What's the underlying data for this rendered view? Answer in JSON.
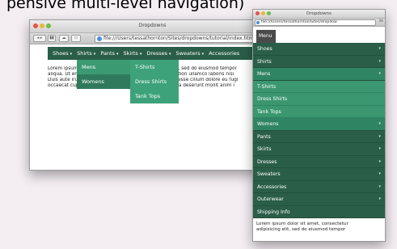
{
  "headline": "pensive multi-level navigation)",
  "desktop": {
    "title": "Dropdowns",
    "url": "file:///Users/tessathornton/Sites/dropdowns/tutorial/index.html",
    "nav": [
      "Shoes",
      "Shirts",
      "Pants",
      "Skirts",
      "Dresses",
      "Sweaters",
      "Accessories"
    ],
    "caret": "▾",
    "dropdown1": [
      "Mens",
      "Womens"
    ],
    "dropdown2": [
      "T-Shirts",
      "Dress Shirts",
      "Tank Tops"
    ],
    "paragraph": [
      "Lorem ipsum dolor sit amet, consectetur adipisicing elit, sed do eiusmod tempor",
      "aliqua. Ut enim ad minim veniam, quis nostrud exercitation ullamco laboris nisi",
      "Duis aute irure dolor in reprehenderit in voluptate velit esse cillum dolore eu fugi",
      "occaecat cupidatat non proident, sunt in culpa qui officia deserunt mollit anim i"
    ]
  },
  "mobile": {
    "title": "Dropdowns",
    "url": "file:///Users/tessathornton/Sites/dropdow",
    "zoom": "36",
    "menu_label": "Menu",
    "items": [
      {
        "label": "Shoes",
        "level": 1,
        "caret": true
      },
      {
        "label": "Shirts",
        "level": 1,
        "caret": true
      },
      {
        "label": "Mens",
        "level": 1,
        "caret": true,
        "active": true
      },
      {
        "label": "T-Shirts",
        "level": 2,
        "caret": false
      },
      {
        "label": "Dress Shirts",
        "level": 2,
        "caret": false
      },
      {
        "label": "Tank Tops",
        "level": 2,
        "caret": false
      },
      {
        "label": "Womens",
        "level": 1,
        "caret": true,
        "active": true
      },
      {
        "label": "Pants",
        "level": 1,
        "caret": true
      },
      {
        "label": "Skirts",
        "level": 1,
        "caret": true
      },
      {
        "label": "Dresses",
        "level": 1,
        "caret": true
      },
      {
        "label": "Sweaters",
        "level": 1,
        "caret": true
      },
      {
        "label": "Accessories",
        "level": 1,
        "caret": true
      },
      {
        "label": "Outerwear",
        "level": 1,
        "caret": true
      },
      {
        "label": "Shipping Info",
        "level": 1,
        "caret": false
      }
    ],
    "paragraph": [
      "Lorem ipsum dolor sit amet, consectetur",
      "adipisicing elit, sed do eiusmod tempor"
    ]
  },
  "colors": {
    "nav": "#2a5e49",
    "dropdown1": "#2f7a5c",
    "dropdown2": "#3da27a",
    "background": "#f4eef3"
  }
}
